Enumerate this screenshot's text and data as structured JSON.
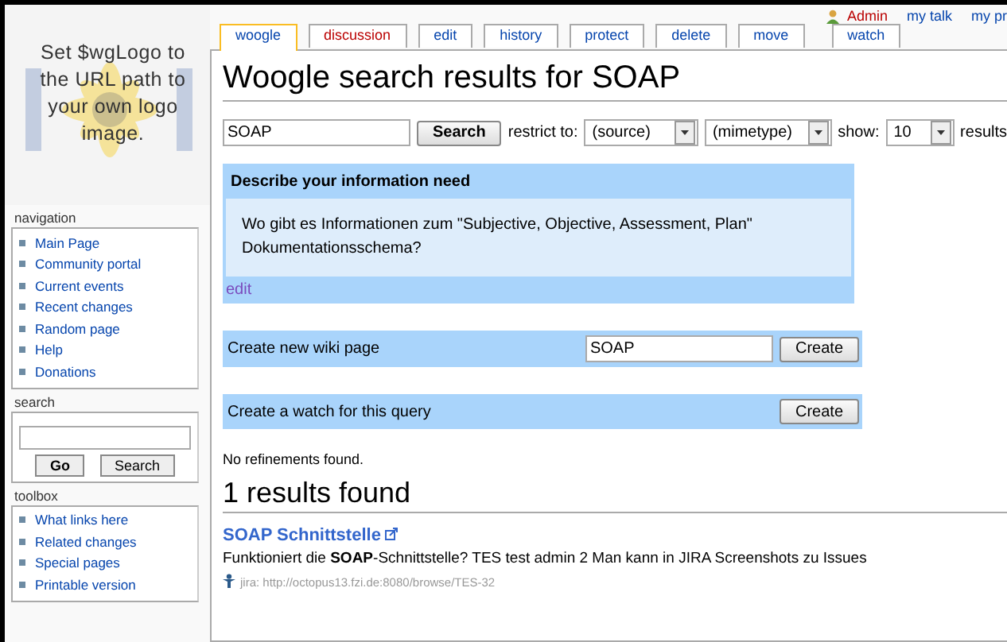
{
  "logo": {
    "text": "Set $wgLogo to the URL path to your own logo image."
  },
  "personal_links": [
    {
      "label": "Admin",
      "kind": "user"
    },
    {
      "label": "my talk",
      "kind": "link"
    },
    {
      "label": "my pr",
      "kind": "link"
    }
  ],
  "tabs": [
    {
      "label": "woogle",
      "selected": true,
      "missing": false
    },
    {
      "label": "discussion",
      "selected": false,
      "missing": true
    },
    {
      "label": "edit",
      "selected": false,
      "missing": false
    },
    {
      "label": "history",
      "selected": false,
      "missing": false
    },
    {
      "label": "protect",
      "selected": false,
      "missing": false
    },
    {
      "label": "delete",
      "selected": false,
      "missing": false
    },
    {
      "label": "move",
      "selected": false,
      "missing": false
    },
    {
      "label": "watch",
      "selected": false,
      "missing": false
    }
  ],
  "sidebar": {
    "navigation": {
      "title": "navigation",
      "items": [
        "Main Page",
        "Community portal",
        "Current events",
        "Recent changes",
        "Random page",
        "Help",
        "Donations"
      ]
    },
    "search": {
      "title": "search",
      "buttons": [
        "Go",
        "Search"
      ]
    },
    "toolbox": {
      "title": "toolbox",
      "items": [
        "What links here",
        "Related changes",
        "Special pages",
        "Printable version"
      ]
    }
  },
  "page_title": "Woogle search results for SOAP",
  "search_bar": {
    "value": "SOAP",
    "button": "Search",
    "restrict_label": "restrict to:",
    "source": "(source)",
    "mimetype": "(mimetype)",
    "show_label": "show:",
    "show": "10",
    "results_label": "results"
  },
  "info_need": {
    "heading": "Describe your information need",
    "text": "Wo gibt es Informationen zum \"Subjective, Objective, Assessment, Plan\" Dokumentationsschema?",
    "edit_link": "edit"
  },
  "create_page": {
    "label": "Create new wiki page",
    "value": "SOAP",
    "button": "Create"
  },
  "create_watch": {
    "label": "Create a watch for this query",
    "button": "Create"
  },
  "refinements": "No refinements found.",
  "results_heading": "1 results found",
  "results": [
    {
      "title": "SOAP Schnittstelle",
      "snippet": "Funktioniert die **SOAP**-Schnittstelle? TES test admin 2 Man kann in JIRA Screenshots zu Issues",
      "source": "jira: http://octopus13.fzi.de:8080/browse/TES-32"
    }
  ]
}
